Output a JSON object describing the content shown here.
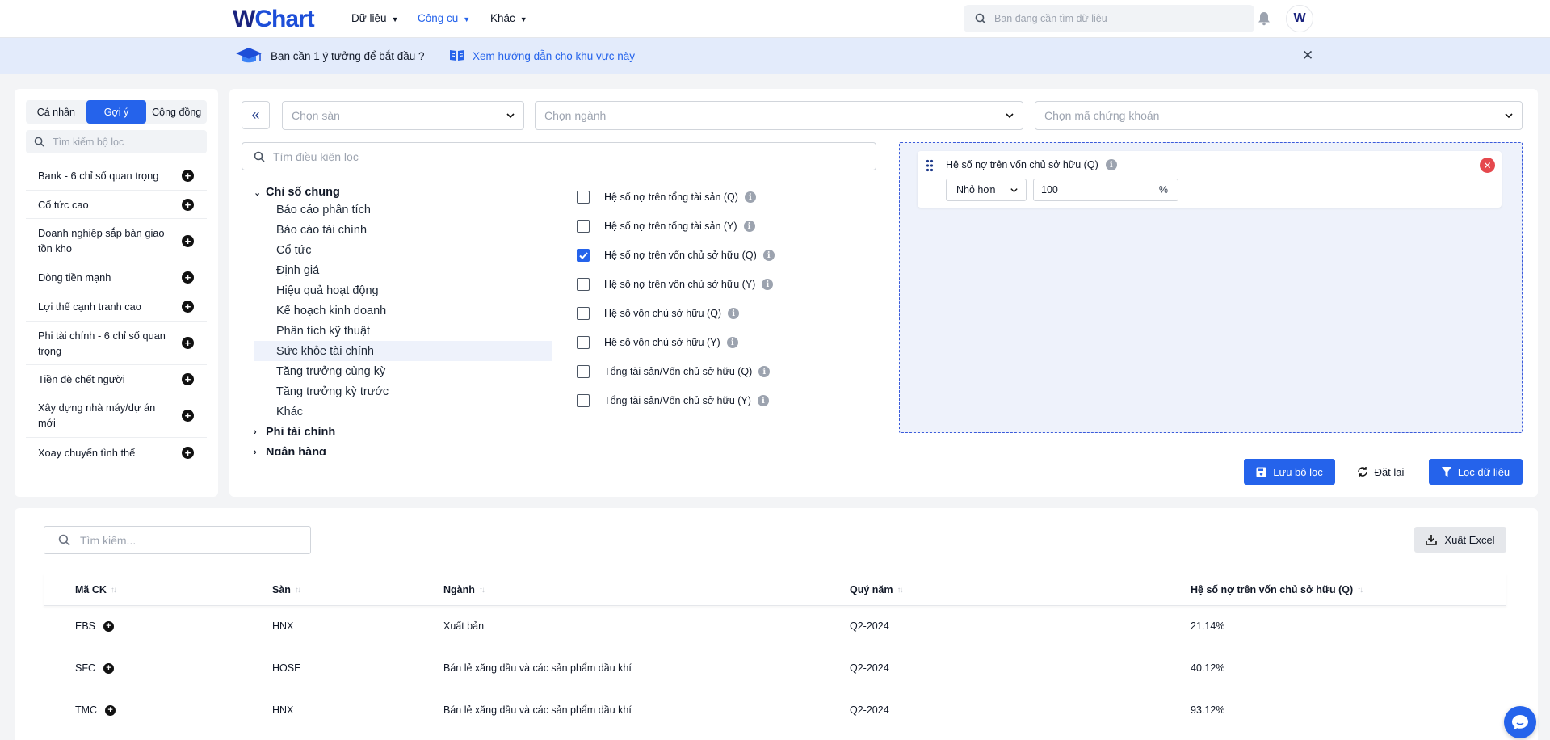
{
  "brand": {
    "logo_w": "W",
    "logo_chart": "Chart"
  },
  "nav": {
    "items": [
      {
        "label": "Dữ liệu",
        "active": false
      },
      {
        "label": "Công cụ",
        "active": true
      },
      {
        "label": "Khác",
        "active": false
      }
    ],
    "search_placeholder": "Bạn đang cần tìm dữ liệu",
    "avatar_letter": "W"
  },
  "banner": {
    "question": "Bạn cần 1 ý tưởng để bắt đầu ?",
    "guide_link": "Xem hướng dẫn cho khu vực này",
    "close": "✕"
  },
  "left": {
    "segments": [
      "Cá nhân",
      "Gợi ý",
      "Cộng đồng"
    ],
    "active_segment": "Gợi ý",
    "search_placeholder": "Tìm kiếm bộ lọc",
    "suggestions": [
      "Bank - 6 chỉ số quan trọng",
      "Cổ tức cao",
      "Doanh nghiệp sắp bàn giao tồn kho",
      "Dòng tiền mạnh",
      "Lợi thế cạnh tranh cao",
      "Phi tài chính - 6 chỉ số quan trọng",
      "Tiền đè chết người",
      "Xây dựng nhà máy/dự án mới",
      "Xoay chuyển tình thế"
    ]
  },
  "filters": {
    "exchange_placeholder": "Chọn sàn",
    "industry_placeholder": "Chọn ngành",
    "ticker_placeholder": "Chọn mã chứng khoán",
    "condition_search_placeholder": "Tìm điều kiện lọc"
  },
  "tree": {
    "groups": [
      {
        "label": "Chỉ số chung",
        "expanded": true,
        "children": [
          "Báo cáo phân tích",
          "Báo cáo tài chính",
          "Cổ tức",
          "Định giá",
          "Hiệu quả hoạt động",
          "Kế hoạch kinh doanh",
          "Phân tích kỹ thuật",
          "Sức khỏe tài chính",
          "Tăng trưởng cùng kỳ",
          "Tăng trưởng kỳ trước",
          "Khác"
        ],
        "active_child": "Sức khỏe tài chính"
      },
      {
        "label": "Phi tài chính",
        "expanded": false
      },
      {
        "label": "Ngân hàng",
        "expanded": false
      }
    ]
  },
  "criteria": [
    {
      "label": "Hệ số nợ trên tổng tài sản (Q)",
      "checked": false
    },
    {
      "label": "Hệ số nợ trên tổng tài sản (Y)",
      "checked": false
    },
    {
      "label": "Hệ số nợ trên vốn chủ sở hữu (Q)",
      "checked": true
    },
    {
      "label": "Hệ số nợ trên vốn chủ sở hữu (Y)",
      "checked": false
    },
    {
      "label": "Hệ số vốn chủ sở hữu (Q)",
      "checked": false
    },
    {
      "label": "Hệ số vốn chủ sở hữu (Y)",
      "checked": false
    },
    {
      "label": "Tổng tài sản/Vốn chủ sở hữu (Q)",
      "checked": false
    },
    {
      "label": "Tổng tài sản/Vốn chủ sở hữu (Y)",
      "checked": false
    }
  ],
  "active_filter": {
    "title": "Hệ số nợ trên vốn chủ sở hữu (Q)",
    "operator": "Nhỏ hơn",
    "value": "100",
    "unit": "%"
  },
  "actions": {
    "save": "Lưu bộ lọc",
    "reset": "Đặt lại",
    "apply": "Lọc dữ liệu"
  },
  "results": {
    "search_placeholder": "Tìm kiếm...",
    "export": "Xuất Excel",
    "columns": [
      "Mã CK",
      "Sàn",
      "Ngành",
      "Quý năm",
      "Hệ số nợ trên vốn chủ sở hữu (Q)"
    ],
    "rows": [
      {
        "ticker": "EBS",
        "exchange": "HNX",
        "industry": "Xuất bản",
        "period": "Q2-2024",
        "value": "21.14%"
      },
      {
        "ticker": "SFC",
        "exchange": "HOSE",
        "industry": "Bán lẻ xăng dầu và các sản phẩm dầu khí",
        "period": "Q2-2024",
        "value": "40.12%"
      },
      {
        "ticker": "TMC",
        "exchange": "HNX",
        "industry": "Bán lẻ xăng dầu và các sản phẩm dầu khí",
        "period": "Q2-2024",
        "value": "93.12%"
      }
    ]
  },
  "colors": {
    "primary": "#2563eb",
    "brand_dark": "#1a237e",
    "banner_bg": "#e3ebfb",
    "danger": "#e5484d"
  }
}
